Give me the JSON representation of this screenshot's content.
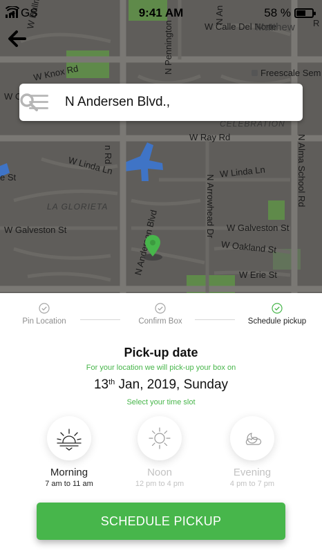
{
  "status_bar": {
    "carrier": "GS",
    "time": "9:41 AM",
    "battery": "58 %",
    "battery_level": 0.58
  },
  "map": {
    "streets": [
      "W Bullmoos",
      "N Pennington",
      "N An",
      "W Calle Del Norte",
      "Matthew",
      "R",
      "W Knox Rd",
      "Freescale Sem",
      "W C",
      "CELEBRATION",
      "W Ray Rd",
      "n Rd",
      "N Alma School Rd",
      "W Linda Ln",
      "e St",
      "W Linda Ln",
      "LA GLORIETA",
      "W Galveston St",
      "N Andersen Blvd",
      "N Arrowhead Dr",
      "W Galveston St",
      "W Oakland St",
      "W Erie St"
    ]
  },
  "search": {
    "value": "N Andersen Blvd.,"
  },
  "steps": [
    {
      "label": "Pin Location",
      "active": false
    },
    {
      "label": "Confirm Box",
      "active": false
    },
    {
      "label": "Schedule pickup",
      "active": true
    }
  ],
  "pickup": {
    "title": "Pick-up date",
    "subtitle": "For your location we will pick-up your box on",
    "date_day": "13",
    "date_suffix": "th",
    "date_rest": " Jan, 2019, Sunday",
    "slot_hint": "Select your time slot"
  },
  "slots": [
    {
      "name": "Morning",
      "hours": "7 am to 11 am",
      "icon": "sunrise-icon",
      "selected": true
    },
    {
      "name": "Noon",
      "hours": "12 pm to 4 pm",
      "icon": "sun-icon",
      "selected": false
    },
    {
      "name": "Evening",
      "hours": "4 pm to 7 pm",
      "icon": "moon-cloud-icon",
      "selected": false
    }
  ],
  "cta": {
    "label": "SCHEDULE PICKUP"
  },
  "colors": {
    "accent": "#47b64b",
    "map_bg": "#5f5d5a",
    "water": "#3f74c6",
    "park": "#5f8a4a"
  }
}
